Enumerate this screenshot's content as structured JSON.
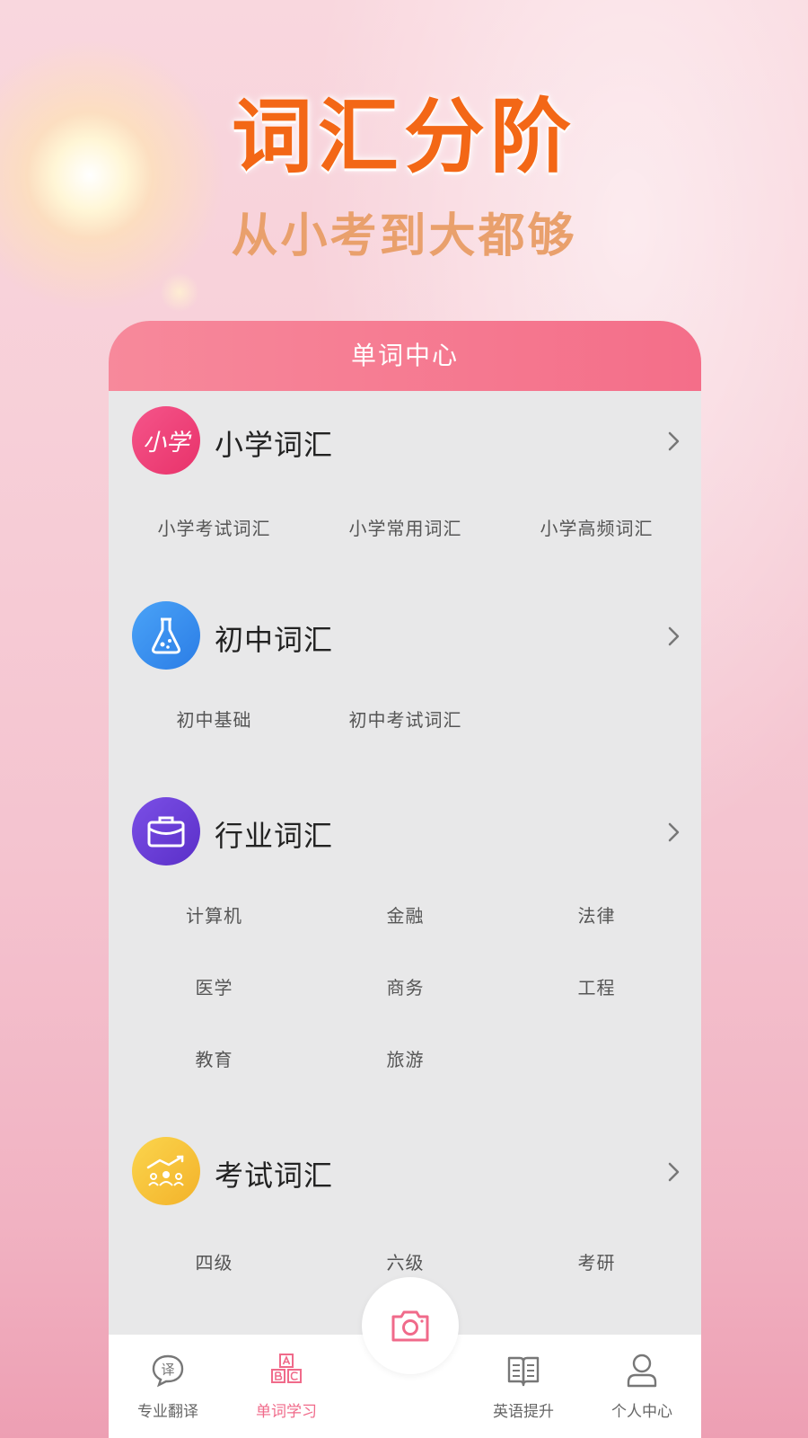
{
  "hero": {
    "title": "词汇分阶",
    "subtitle": "从小考到大都够"
  },
  "card": {
    "header": "单词中心"
  },
  "sections": [
    {
      "title": "小学词汇",
      "icon": "calligraphy-xiaoxue-icon",
      "icon_text": "小学",
      "color": "#f0427a",
      "items": [
        "小学考试词汇",
        "小学常用词汇",
        "小学高频词汇"
      ]
    },
    {
      "title": "初中词汇",
      "icon": "flask-icon",
      "color": "#3b8ff0",
      "items": [
        "初中基础",
        "初中考试词汇"
      ]
    },
    {
      "title": "行业词汇",
      "icon": "briefcase-icon",
      "color": "#6a3fd8",
      "items": [
        "计算机",
        "金融",
        "法律",
        "医学",
        "商务",
        "工程",
        "教育",
        "旅游"
      ]
    },
    {
      "title": "考试词汇",
      "icon": "exam-rank-icon",
      "color": "#f7c23a",
      "items": [
        "四级",
        "六级",
        "考研"
      ]
    }
  ],
  "tabbar": {
    "tabs": [
      {
        "label": "专业翻译",
        "icon": "translate-chat-icon",
        "icon_text": "译",
        "active": false
      },
      {
        "label": "单词学习",
        "icon": "abc-blocks-icon",
        "active": true
      },
      {
        "label": "英语提升",
        "icon": "open-book-icon",
        "active": false
      },
      {
        "label": "个人中心",
        "icon": "user-icon",
        "active": false
      }
    ],
    "center": {
      "icon": "camera-icon"
    }
  },
  "colors": {
    "accent": "#f06a8a",
    "hero_title": "#f36716",
    "hero_subtitle": "#e9a06c"
  }
}
